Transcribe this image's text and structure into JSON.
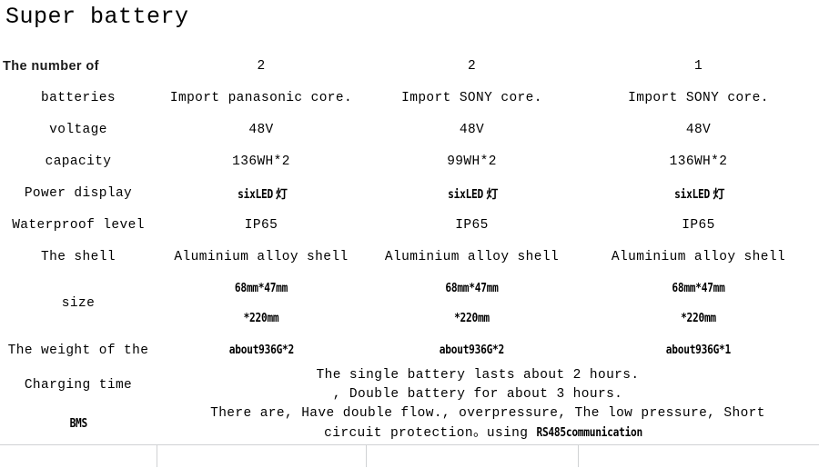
{
  "title": "Super battery",
  "table": {
    "header": {
      "label": "The number of",
      "col1": "2",
      "col2": "2",
      "col3": "1"
    },
    "rows": [
      {
        "label": "batteries",
        "col1": "Import panasonic core.",
        "col2": "Import SONY core.",
        "col3": "Import SONY core."
      },
      {
        "label": "voltage",
        "col1": "48V",
        "col2": "48V",
        "col3": "48V"
      },
      {
        "label": "capacity",
        "col1": "136WH*2",
        "col2": "99WH*2",
        "col3": "136WH*2"
      },
      {
        "label": "Power display",
        "col1": "sixLED",
        "col1_cjk": "灯",
        "col2": "sixLED",
        "col2_cjk": "灯",
        "col3": "sixLED",
        "col3_cjk": "灯"
      },
      {
        "label": "Waterproof level",
        "col1": "IP65",
        "col2": "IP65",
        "col3": "IP65"
      },
      {
        "label": "The shell",
        "col1": "Aluminium alloy shell",
        "col2": "Aluminium alloy shell",
        "col3": "Aluminium alloy shell"
      }
    ],
    "size_row": {
      "label": "size",
      "col1_line1": "68mm*47mm",
      "col1_line2": "*220mm",
      "col2_line1": "68mm*47mm",
      "col2_line2": "*220mm",
      "col3_line1": "68mm*47mm",
      "col3_line2": "*220mm"
    },
    "weight_row": {
      "label": "The weight of the",
      "col1": "about936G*2",
      "col2": "about936G*2",
      "col3": "about936G*1"
    },
    "charging_row": {
      "label": "Charging time",
      "line1": "The single battery lasts about 2 hours.",
      "line2": ", Double battery for about 3 hours."
    },
    "bms_row": {
      "label": "BMS",
      "line1": "There are, Have double flow., overpressure, The low pressure, Short",
      "line2_a": "circuit protection。using",
      "line2_b": "RS485communication"
    }
  }
}
